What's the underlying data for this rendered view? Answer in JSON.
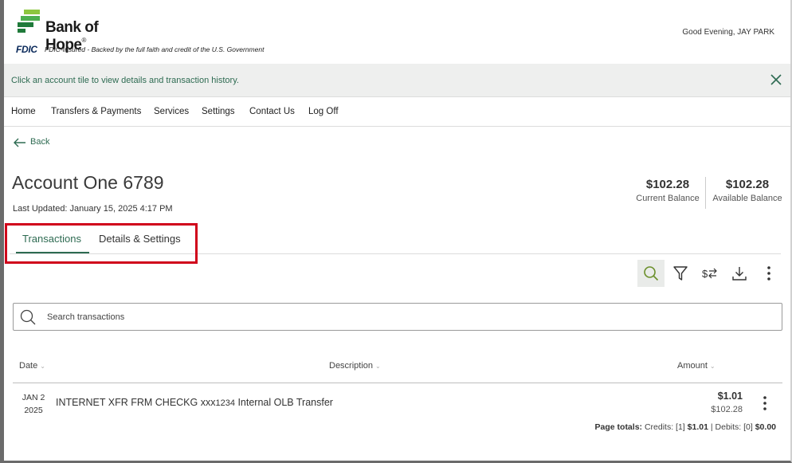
{
  "header": {
    "bank_name": "Bank of Hope",
    "fdic_badge": "FDIC",
    "fdic_text": "FDIC-Insured - Backed by the full faith and credit of the U.S. Government",
    "greeting": "Good Evening, JAY PARK"
  },
  "banner": {
    "message": "Click an account tile to view details and transaction history."
  },
  "nav": {
    "items": [
      "Home",
      "Transfers & Payments",
      "Services",
      "Settings",
      "Contact Us",
      "Log Off"
    ]
  },
  "back_label": "Back",
  "account": {
    "title": "Account One 6789",
    "last_updated": "Last Updated: January 15, 2025 4:17 PM",
    "current_balance": "$102.28",
    "current_balance_label": "Current Balance",
    "available_balance": "$102.28",
    "available_balance_label": "Available Balance"
  },
  "tabs": [
    {
      "label": "Transactions",
      "active": true
    },
    {
      "label": "Details & Settings",
      "active": false
    }
  ],
  "toolbar": {
    "icons": [
      "search-icon",
      "filter-icon",
      "transfer-dollar-icon",
      "download-icon",
      "more-vertical-icon"
    ]
  },
  "search": {
    "placeholder": "Search transactions",
    "value": ""
  },
  "table": {
    "headers": {
      "date": "Date",
      "description": "Description",
      "amount": "Amount"
    },
    "rows": [
      {
        "date_month_day": "JAN 2",
        "date_year": "2025",
        "desc_part1": "INTERNET XFR FRM CHECKG xxx",
        "desc_acct": "1234",
        "desc_part2": "Internal OLB Transfer",
        "amount": "$1.01",
        "running_balance": "$102.28"
      }
    ]
  },
  "totals": {
    "label": "Page totals:",
    "credits_text": "Credits: [1]",
    "credits_amount": "$1.01",
    "separator": "|",
    "debits_text": "Debits: [0]",
    "debits_amount": "$0.00"
  },
  "colors": {
    "accent_green": "#2e6b52",
    "highlight_red": "#d0021b",
    "logo_green_light": "#8cc63f",
    "logo_green_dark": "#1f7a3a"
  }
}
